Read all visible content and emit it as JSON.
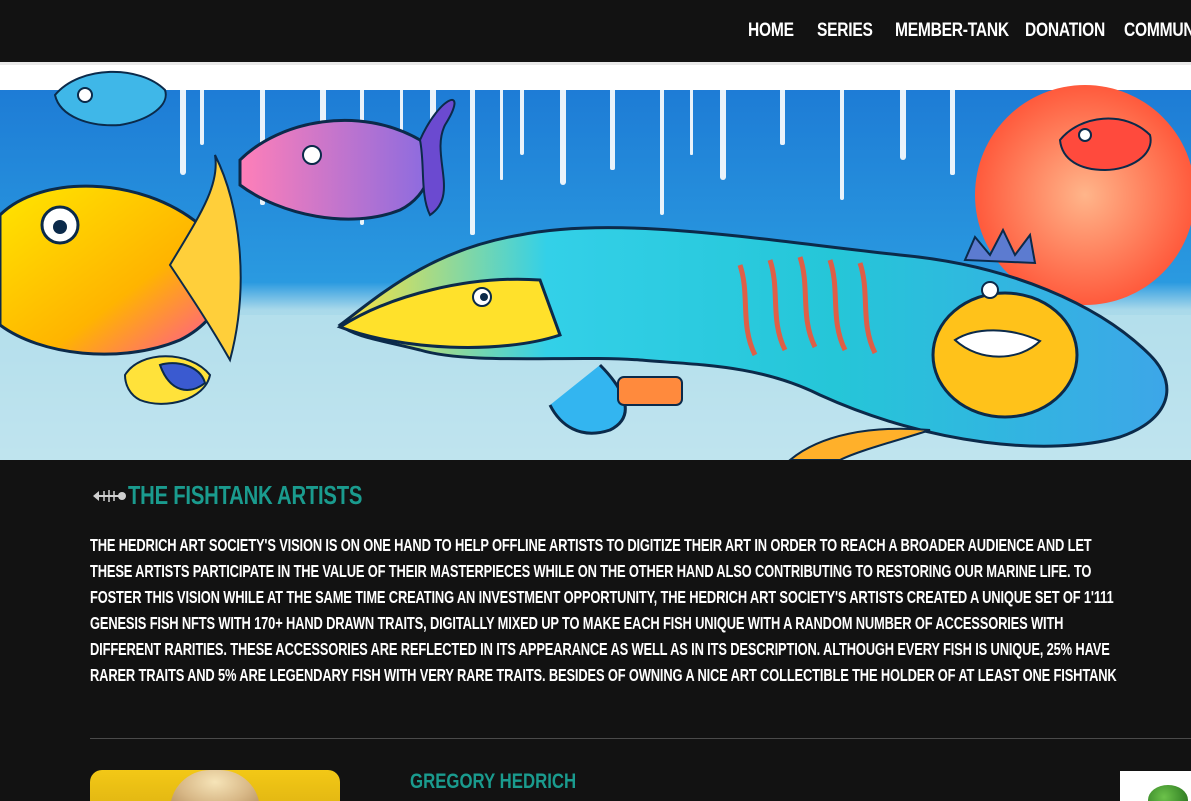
{
  "nav": {
    "items": [
      "HOME",
      "SERIES",
      "MEMBER-TANK",
      "DONATION",
      "COMMUNITY"
    ]
  },
  "hero": {
    "icon": "fish-artwork-banner"
  },
  "section": {
    "title": "THE FISHTANK ARTISTS",
    "title_icon": "fish-bone-icon",
    "description": "THE HEDRICH ART SOCIETY'S VISION IS ON ONE HAND TO HELP OFFLINE ARTISTS TO DIGITIZE THEIR ART IN ORDER TO REACH A BROADER AUDIENCE AND LET THESE ARTISTS PARTICIPATE IN THE VALUE OF THEIR MASTERPIECES WHILE ON THE OTHER HAND ALSO CONTRIBUTING TO RESTORING OUR MARINE LIFE. TO FOSTER THIS VISION WHILE AT THE SAME TIME CREATING AN INVESTMENT OPPORTUNITY, THE HEDRICH ART SOCIETY'S ARTISTS CREATED A UNIQUE SET OF 1'111 GENESIS FISH NFTS WITH 170+ HAND DRAWN TRAITS, DIGITALLY MIXED UP TO MAKE EACH FISH UNIQUE WITH A RANDOM NUMBER OF ACCESSORIES WITH DIFFERENT RARITIES. THESE ACCESSORIES ARE REFLECTED IN ITS APPEARANCE AS WELL AS IN ITS DESCRIPTION. ALTHOUGH EVERY FISH IS UNIQUE, 25% HAVE RARER TRAITS AND 5% ARE LEGENDARY FISH WITH VERY RARE TRAITS. BESIDES OF OWNING A NICE ART COLLECTIBLE THE HOLDER OF AT LEAST ONE FISHTANK NFT ALSO ENJOYS ALL THE BENEFITS THAT A MEMBERSHIP IN THE FISHTANK METAVERSE OFFERS."
  },
  "artist": {
    "name": "GREGORY HEDRICH"
  },
  "colors": {
    "accent": "#1a9b8e",
    "background": "#121212",
    "text": "#ffffff"
  }
}
